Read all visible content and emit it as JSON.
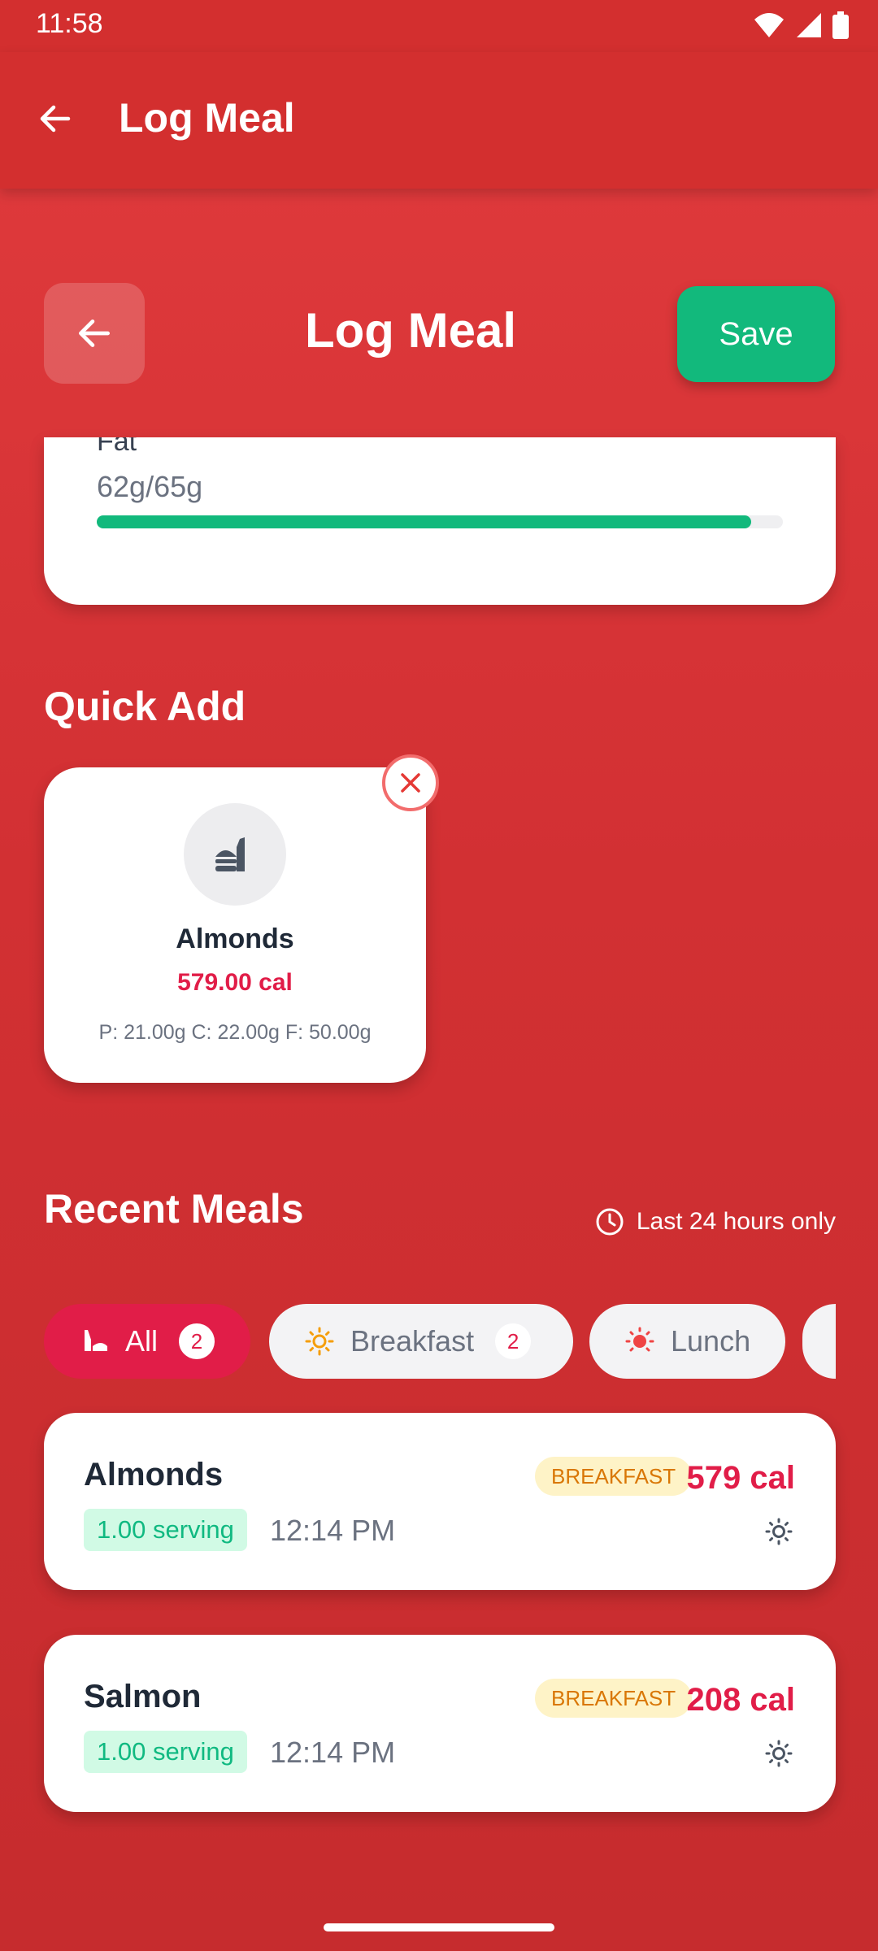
{
  "status_bar": {
    "time": "11:58"
  },
  "app_bar": {
    "title": "Log Meal"
  },
  "header": {
    "title": "Log Meal",
    "save_label": "Save"
  },
  "macro": {
    "name": "Fat",
    "value": "62g/65g",
    "progress": 0.954
  },
  "quick_add": {
    "title": "Quick Add",
    "items": [
      {
        "name": "Almonds",
        "calories": "579.00 cal",
        "macros": "P: 21.00g  C: 22.00g  F: 50.00g",
        "icon": "fast-food-icon"
      }
    ]
  },
  "recent": {
    "title": "Recent Meals",
    "note": "Last 24 hours only",
    "filters": [
      {
        "label": "All",
        "count": "2",
        "icon": "utensils-icon"
      },
      {
        "label": "Breakfast",
        "count": "2",
        "icon": "sun-icon"
      },
      {
        "label": "Lunch",
        "icon": "sun-high-icon"
      }
    ],
    "meals": [
      {
        "name": "Almonds",
        "serving": "1.00 serving",
        "time": "12:14 PM",
        "tag": "BREAKFAST",
        "calories": "579 cal"
      },
      {
        "name": "Salmon",
        "serving": "1.00 serving",
        "time": "12:14 PM",
        "tag": "BREAKFAST",
        "calories": "208 cal"
      }
    ]
  },
  "colors": {
    "primary": "#D32F2F",
    "accent": "#E11D48",
    "success": "#12B97C",
    "breakfast_tag": "#FEF3C7"
  }
}
